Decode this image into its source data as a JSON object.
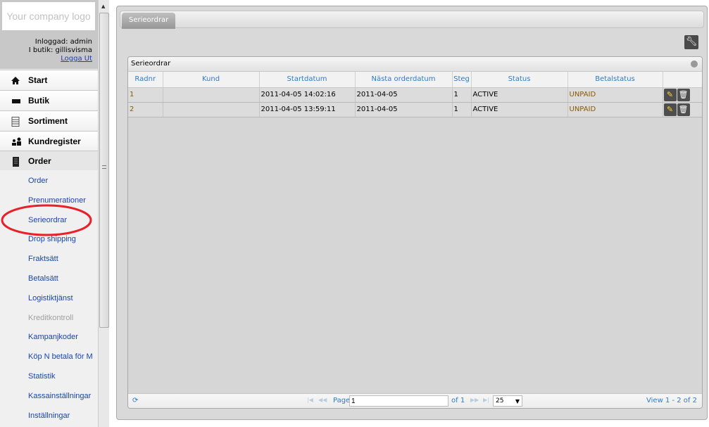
{
  "sidebar": {
    "logo": "Your company logo",
    "logged_in": "Inloggad: admin",
    "store": "I butik: gillisvisma",
    "logout": "Logga Ut",
    "menu": [
      {
        "label": "Start",
        "icon": "home-icon"
      },
      {
        "label": "Butik",
        "icon": "store-icon"
      },
      {
        "label": "Sortiment",
        "icon": "list-icon"
      },
      {
        "label": "Kundregister",
        "icon": "users-icon"
      },
      {
        "label": "Order",
        "icon": "document-icon"
      }
    ],
    "submenu": [
      "Order",
      "Prenumerationer",
      "Serieordrar",
      "Drop shipping",
      "Fraktsätt",
      "Betalsätt",
      "Logistiktjänst",
      "Kreditkontroll",
      "Kampanjkoder",
      "Köp N betala för M",
      "Statistik",
      "Kassainställningar",
      "Inställningar"
    ],
    "disabled_item": "Kreditkontroll",
    "highlight_color": "#e8202a"
  },
  "main": {
    "tab": "Serieordrar",
    "grid": {
      "title": "Serieordrar",
      "columns": [
        "Radnr",
        "Kund",
        "Startdatum",
        "Nästa orderdatum",
        "Steg",
        "Status",
        "Betalstatus",
        ""
      ],
      "rows": [
        [
          "1",
          "",
          "2011-04-05 14:02:16",
          "2011-04-05",
          "1",
          "ACTIVE",
          "UNPAID"
        ],
        [
          "2",
          "",
          "2011-04-05 13:59:11",
          "2011-04-05",
          "1",
          "ACTIVE",
          "UNPAID"
        ]
      ],
      "pager": {
        "page_label": "Page",
        "page": "1",
        "of": "of 1",
        "rows_per_page": "25",
        "view": "View 1 - 2 of 2"
      }
    }
  }
}
